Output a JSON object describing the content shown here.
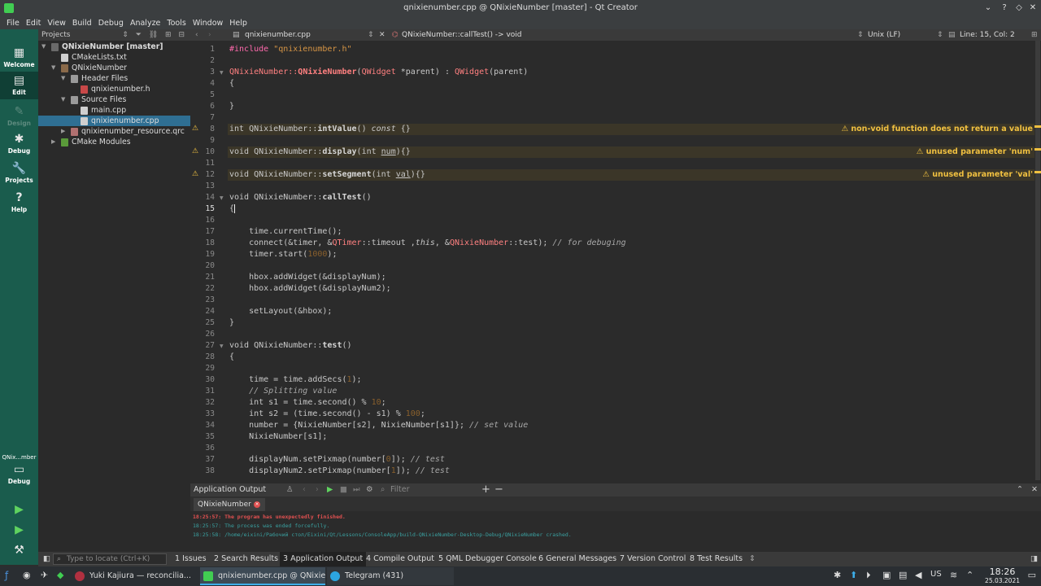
{
  "window": {
    "title": "qnixienumber.cpp @ QNixieNumber [master] - Qt Creator"
  },
  "menu": [
    "File",
    "Edit",
    "View",
    "Build",
    "Debug",
    "Analyze",
    "Tools",
    "Window",
    "Help"
  ],
  "modes": [
    {
      "label": "Welcome"
    },
    {
      "label": "Edit"
    },
    {
      "label": "Design"
    },
    {
      "label": "Debug"
    },
    {
      "label": "Projects"
    },
    {
      "label": "Help"
    }
  ],
  "kit": {
    "name": "QNix...mber",
    "mode": "Debug"
  },
  "projects": {
    "header": "Projects",
    "tree": [
      {
        "label": "QNixieNumber [master]"
      },
      {
        "label": "CMakeLists.txt"
      },
      {
        "label": "QNixieNumber"
      },
      {
        "label": "Header Files"
      },
      {
        "label": "qnixienumber.h"
      },
      {
        "label": "Source Files"
      },
      {
        "label": "main.cpp"
      },
      {
        "label": "qnixienumber.cpp"
      },
      {
        "label": "qnixienumber_resource.qrc"
      },
      {
        "label": "CMake Modules"
      }
    ]
  },
  "editor": {
    "file": "qnixienumber.cpp",
    "symbol": "QNixieNumber::callTest() -> void",
    "line_ending": "Unix (LF)",
    "position": "Line: 15, Col: 2",
    "lines": [
      "1",
      "2",
      "3",
      "4",
      "5",
      "6",
      "7",
      "8",
      "9",
      "10",
      "11",
      "12",
      "13",
      "14",
      "15",
      "16",
      "17",
      "18",
      "19",
      "20",
      "21",
      "22",
      "23",
      "24",
      "25",
      "26",
      "27",
      "28",
      "29",
      "30",
      "31",
      "32",
      "33",
      "34",
      "35",
      "36",
      "37",
      "38"
    ],
    "warnings": [
      {
        "line": 8,
        "text": "non-void function does not return a value"
      },
      {
        "line": 10,
        "text": "unused parameter 'num'"
      },
      {
        "line": 12,
        "text": "unused parameter 'val'"
      }
    ],
    "code": {
      "l1a": "#include ",
      "l1b": "\"qnixienumber.h\"",
      "l3a": "QNixieNumber::",
      "l3b": "QNixieNumber",
      "l3c": "(",
      "l3d": "QWidget",
      "l3e": " *parent) : ",
      "l3f": "QWidget",
      "l3g": "(parent)",
      "l4": "{",
      "l6": "}",
      "l8a": "int QNixieNumber::",
      "l8b": "intValue",
      "l8c": "() ",
      "l8d": "const",
      "l8e": " {}",
      "l10a": "void QNixieNumber::",
      "l10b": "display",
      "l10c": "(int ",
      "l10d": "num",
      "l10e": "){}",
      "l12a": "void QNixieNumber::",
      "l12b": "setSegment",
      "l12c": "(int ",
      "l12d": "val",
      "l12e": "){}",
      "l14a": "void QNixieNumber::",
      "l14b": "callTest",
      "l14c": "()",
      "l15": "{",
      "l17": "    time.currentTime();",
      "l18a": "    connect(&timer, &",
      "l18b": "QTimer",
      "l18c": "::timeout ,",
      "l18d": "this",
      "l18e": ", &",
      "l18f": "QNixieNumber",
      "l18g": "::test); ",
      "l18h": "// for debuging",
      "l19a": "    timer.start(",
      "l19b": "1000",
      "l19c": ");",
      "l21": "    hbox.addWidget(&displayNum);",
      "l22": "    hbox.addWidget(&displayNum2);",
      "l24": "    setLayout(&hbox);",
      "l25": "}",
      "l27a": "void QNixieNumber::",
      "l27b": "test",
      "l27c": "()",
      "l28": "{",
      "l30a": "    time = time.addSecs(",
      "l30b": "1",
      "l30c": ");",
      "l31": "    // Splitting value",
      "l32a": "    int s1 = time.second() % ",
      "l32b": "10",
      "l32c": ";",
      "l33a": "    int s2 = (time.second() - s1) % ",
      "l33b": "100",
      "l33c": ";",
      "l34a": "    number = {NixieNumber[s2], NixieNumber[s1]}; ",
      "l34b": "// set value",
      "l35": "    NixieNumber[s1];",
      "l37a": "    displayNum.setPixmap(number[",
      "l37b": "0",
      "l37c": "]); ",
      "l37d": "// test",
      "l38a": "    displayNum2.setPixmap(number[",
      "l38b": "1",
      "l38c": "]); ",
      "l38d": "// test"
    }
  },
  "output": {
    "title": "Application Output",
    "filter_placeholder": "Filter",
    "tab": "QNixieNumber",
    "lines": [
      "18:25:57: The program has unexpectedly finished.",
      "18:25:57: The process was ended forcefully.",
      "18:25:58: /home/eixini/Рабочий стол/Eixini/Qt/Lessons/ConsoleApp/build-QNixieNumber-Desktop-Debug/QNixieNumber crashed."
    ]
  },
  "statusbar": {
    "locator_placeholder": "Type to locate (Ctrl+K)",
    "panes": [
      "1 Issues",
      "2 Search Results",
      "3 Application Output",
      "4 Compile Output",
      "5 QML Debugger Console",
      "6 General Messages",
      "7 Version Control",
      "8 Test Results"
    ]
  },
  "taskbar": {
    "items": [
      "Yuki Kajiura — reconcilia...",
      "qnixienumber.cpp @ QNixie...",
      "Telegram (431)"
    ],
    "lang": "US",
    "time": "18:26",
    "date": "25.03.2021"
  },
  "colors": {
    "accent": "#1a5c4d",
    "warning": "#f0c040",
    "error": "#e05050"
  }
}
